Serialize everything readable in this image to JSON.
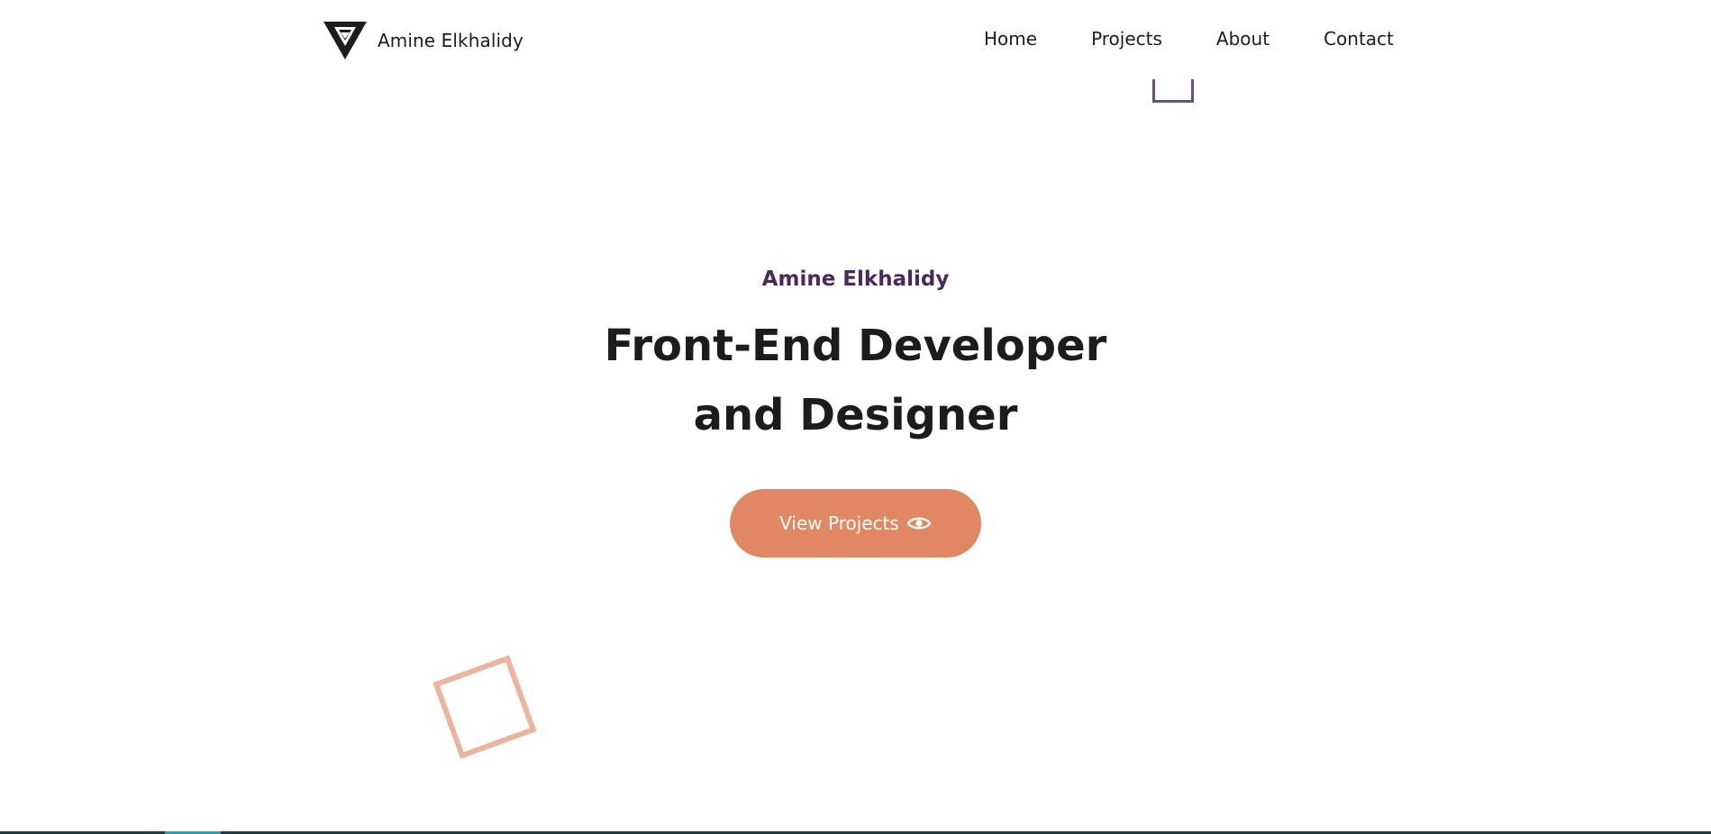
{
  "brand": {
    "name": "Amine Elkhalidy",
    "logo_icon": "triangle-logo-icon"
  },
  "nav": {
    "items": [
      {
        "label": "Home"
      },
      {
        "label": "Projects"
      },
      {
        "label": "About"
      },
      {
        "label": "Contact"
      }
    ]
  },
  "hero": {
    "eyebrow": "Amine Elkhalidy",
    "headline_line1": "Front-End Developer",
    "headline_line2": "and Designer",
    "cta_label": "View Projects",
    "cta_icon": "eye-icon"
  },
  "colors": {
    "accent": "#e08863",
    "eyebrow": "#4a2a5e",
    "text": "#1c1c1c",
    "deco_square": "#ecb39e",
    "deco_bracket": "#6d4e80"
  }
}
